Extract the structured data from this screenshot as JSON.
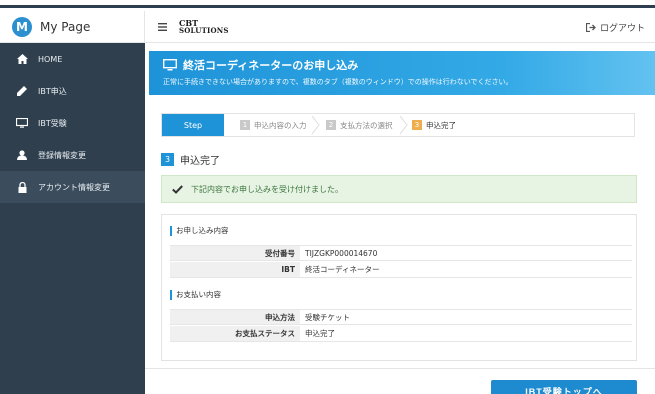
{
  "sidebar": {
    "brand": {
      "logo_letter": "M",
      "title": "My Page"
    },
    "items": [
      {
        "label": "HOME",
        "icon": "home-icon"
      },
      {
        "label": "IBT申込",
        "icon": "pencil-icon"
      },
      {
        "label": "IBT受験",
        "icon": "monitor-icon"
      },
      {
        "label": "登録情報変更",
        "icon": "user-icon"
      },
      {
        "label": "アカウント情報変更",
        "icon": "lock-icon",
        "active": true
      }
    ]
  },
  "header": {
    "logo_line1": "CBT",
    "logo_line2": "SOLUTIONS",
    "logout_label": "ログアウト"
  },
  "banner": {
    "title": "終活コーディネーターのお申し込み",
    "subtitle": "正常に手続きできない場合がありますので、複数のタブ（複数のウィンドウ）での操作は行わないでください。"
  },
  "steps": {
    "label": "Step",
    "items": [
      {
        "num": "1",
        "label": "申込内容の入力"
      },
      {
        "num": "2",
        "label": "支払方法の選択"
      },
      {
        "num": "3",
        "label": "申込完了",
        "current": true
      }
    ]
  },
  "section": {
    "num": "3",
    "title": "申込完了"
  },
  "alert": {
    "message": "下記内容でお申し込みを受け付けました。"
  },
  "details": {
    "application_title": "お申し込み内容",
    "application_rows": [
      {
        "key": "受付番号",
        "value": "TIJZGKP000014670"
      },
      {
        "key": "IBT",
        "value": "終活コーディネーター"
      }
    ],
    "payment_title": "お支払い内容",
    "payment_rows": [
      {
        "key": "申込方法",
        "value": "受験チケット"
      },
      {
        "key": "お支払ステータス",
        "value": "申込完了"
      }
    ]
  },
  "actions": {
    "primary_label": "IBT受験トップへ"
  },
  "colors": {
    "sidebar_bg": "#2f3f4e",
    "accent_blue": "#1e93d8",
    "step_current": "#f0ad4e",
    "alert_bg": "#e7f4e4"
  }
}
